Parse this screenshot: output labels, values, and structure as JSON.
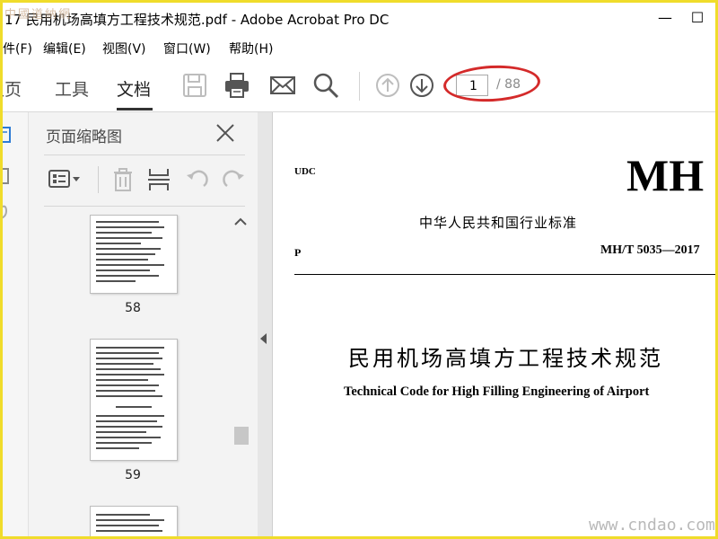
{
  "window": {
    "title": "17 民用机场高填方工程技术规范.pdf - Adobe Acrobat Pro DC",
    "minimize_glyph": "—",
    "maximize_glyph": "☐"
  },
  "watermark_top": "中國道納網",
  "menu": {
    "items": [
      "件(F)",
      "编辑(E)",
      "视图(V)",
      "窗口(W)",
      "帮助(H)"
    ]
  },
  "toolbar": {
    "tabs": [
      "主页",
      "工具",
      "文档"
    ],
    "active_tab": "文档",
    "icons": [
      "save-icon",
      "print-icon",
      "email-icon",
      "search-icon",
      "page-up-icon",
      "page-down-icon"
    ],
    "page_current": "1",
    "page_total": "/ 88"
  },
  "thumbnails_panel": {
    "title": "页面缩略图",
    "tools": [
      "options-icon",
      "delete-icon",
      "insert-icon",
      "undo-icon",
      "redo-icon"
    ],
    "thumbs": [
      {
        "label": "58"
      },
      {
        "label": "59"
      }
    ]
  },
  "document": {
    "udc": "UDC",
    "code_short": "MH",
    "standard_name": "中华人民共和国行业标准",
    "p": "P",
    "code_full": "MH/T 5035—2017",
    "title_cn": "民用机场高填方工程技术规范",
    "title_en": "Technical Code for High Filling Engineering of Airport"
  },
  "watermark_bottom": "www.cndao.com",
  "colors": {
    "frame": "#f0dc2b",
    "annotation": "#d42a2a"
  }
}
